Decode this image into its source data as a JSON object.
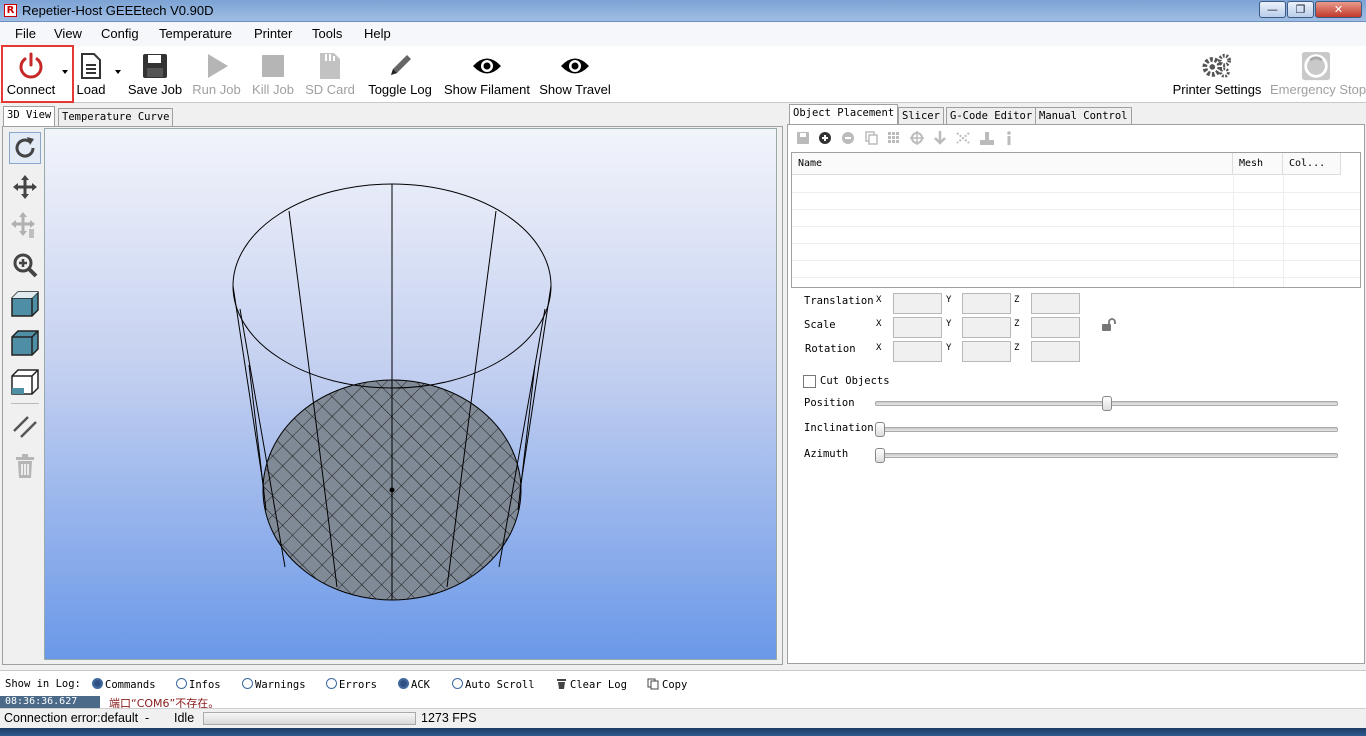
{
  "window": {
    "title": "Repetier-Host GEEEtech V0.90D",
    "app_icon_letter": "R"
  },
  "menu": [
    "File",
    "View",
    "Config",
    "Temperature",
    "Printer",
    "Tools",
    "Help"
  ],
  "toolbar": {
    "connect": "Connect",
    "load": "Load",
    "save_job": "Save Job",
    "run_job": "Run Job",
    "kill_job": "Kill Job",
    "sd_card": "SD Card",
    "toggle_log": "Toggle Log",
    "show_filament": "Show Filament",
    "show_travel": "Show Travel",
    "printer_settings": "Printer Settings",
    "emergency_stop": "Emergency Stop"
  },
  "left_tabs": [
    "3D View",
    "Temperature Curve"
  ],
  "right_tabs": [
    "Object Placement",
    "Slicer",
    "G-Code Editor",
    "Manual Control"
  ],
  "object_grid": {
    "columns": [
      "Name",
      "Mesh",
      "Col..."
    ]
  },
  "placement": {
    "translation": "Translation",
    "scale": "Scale",
    "rotation": "Rotation",
    "x": "X",
    "y": "Y",
    "z": "Z",
    "cut_objects": "Cut Objects",
    "position": "Position",
    "inclination": "Inclination",
    "azimuth": "Azimuth",
    "position_level": 0.5,
    "inclination_level": 0.0,
    "azimuth_level": 0.0
  },
  "log": {
    "show_in_log": "Show in Log:",
    "commands": "Commands",
    "infos": "Infos",
    "warnings": "Warnings",
    "errors": "Errors",
    "ack": "ACK",
    "auto_scroll": "Auto Scroll",
    "clear_log": "Clear Log",
    "copy": "Copy",
    "entry_time": "08:36:36.627",
    "entry_text": "端口“COM6”不存在。"
  },
  "status": {
    "connection": "Connection error:default  -",
    "state": "Idle",
    "fps": "1273 FPS"
  },
  "colors": {
    "accent_red": "#c62828",
    "highlight": "#e53935",
    "viewport_bottom": "#6a98e8",
    "bed": "#808a96"
  }
}
